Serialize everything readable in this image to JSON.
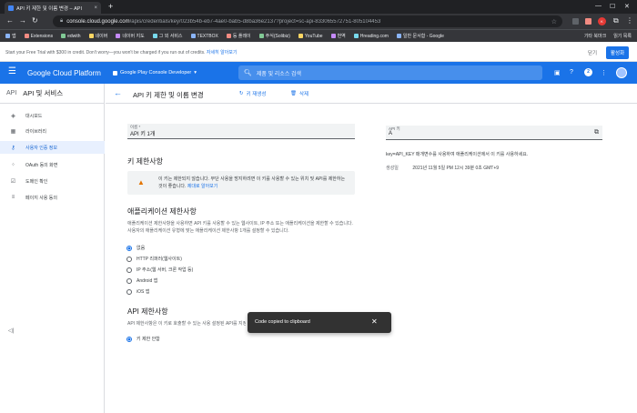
{
  "browser": {
    "tab_title": "API 키 제한 및 이름 변경 – API",
    "tab_close": "×",
    "new_tab": "+",
    "url_host": "console.cloud.google.com",
    "url_path": "/apis/credentials/key/023b54b-eb7-4ae0-bab5-d8ba36e2137?project=sc-api-833065572751-805104453",
    "bookmarks": [
      "앱",
      "Extensions",
      "edwith",
      "네이버",
      "네이버 지도",
      "그 외 서비스",
      "TEXTBOX",
      "등 플레이",
      "주식(Solibiz)",
      "YouTube",
      "번역",
      "Hreading.com",
      "일반 문서함 - Google"
    ],
    "bookmarks_right": [
      "기타 북마크",
      "읽기 목록"
    ],
    "profile_initial": "K"
  },
  "trial": {
    "message": "Start your Free Trial with $300 in credit. Don't worry—you won't be charged if you run out of credits.",
    "learn_more": "자세히 알아보기",
    "dismiss": "닫기",
    "activate": "활성화"
  },
  "header": {
    "brand": "Google Cloud Platform",
    "project": "Google Play Console Developer",
    "search_placeholder": "제품 및 리소스 검색",
    "notification_count": "2"
  },
  "sidebar": {
    "api_badge": "API",
    "title": "API 및 서비스",
    "items": [
      {
        "icon": "◈",
        "label": "대시보드"
      },
      {
        "icon": "▦",
        "label": "라이브러리"
      },
      {
        "icon": "⚷",
        "label": "사용자 인증 정보"
      },
      {
        "icon": "⁘",
        "label": "OAuth 동의 화면"
      },
      {
        "icon": "☑",
        "label": "도메인 확인"
      },
      {
        "icon": "≡",
        "label": "페이지 사용 동의"
      }
    ],
    "collapse": "◁|"
  },
  "toolbar": {
    "title": "API 키 제한 및 이름 변경",
    "regenerate": "키 재생성",
    "delete": "삭제"
  },
  "form": {
    "name_label": "이름 *",
    "name_value": "API 키 1개",
    "key_restrictions_title": "키 제한사항",
    "warning_text": "이 키는 제한되지 않습니다. 무단 사용을 방지하려면 이 키를 사용할 수 있는 위치 및 API를 제한하는 것이 좋습니다.",
    "warning_link": "제대로 알아보기",
    "app_restrictions_title": "애플리케이션 제한사항",
    "app_restrictions_desc": "애플리케이션 제한사항을 사용하면 API 키를 사용할 수 있는 웹사이트, IP 주소 또는 애플리케이션을 제한할 수 있습니다. 사용자의 애플리케이션 유형에 맞는 애플리케이션 제한사항 1개를 설정할 수 있습니다.",
    "app_options": [
      "없음",
      "HTTP 리퍼러(웹사이트)",
      "IP 주소(웹 서버, 크론 작업 등)",
      "Android 앱",
      "iOS 앱"
    ],
    "api_restrictions_title": "API 제한사항",
    "api_restrictions_desc": "API 제한사항은 이 키로 호출할 수 있는 사용 설정된 API를 지정합니다.",
    "api_option_first": "키 제한 안함"
  },
  "right": {
    "api_key_label": "API 키",
    "api_key_value": "A",
    "usage_text": "key=API_KEY 매개변수를 사용하여 애플리케이션에서 이 키를 사용하세요.",
    "created_label": "생성일",
    "created_value": "2021년 11월 5일 PM 12시 39분 0초 GMT+9"
  },
  "snackbar": {
    "text": "Code copied to clipboard",
    "close": "✕"
  },
  "colors": {
    "primary": "#1a73e8",
    "warning": "#e37400",
    "chrome_dark": "#202124"
  }
}
